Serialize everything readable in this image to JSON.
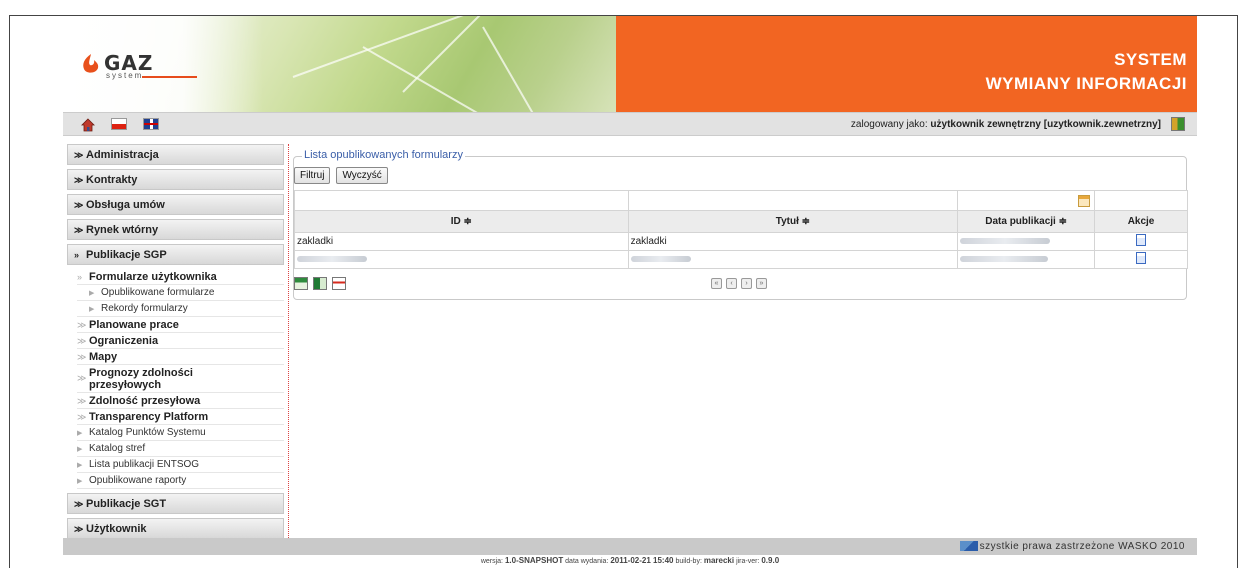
{
  "header": {
    "logo_word": "GAZ",
    "logo_sub": "system",
    "title_line1": "SYSTEM",
    "title_line2": "WYMIANY INFORMACJI",
    "colors": {
      "accent": "#f26522",
      "link": "#3a5ea8"
    }
  },
  "topbar": {
    "icons": [
      "home-icon",
      "polish-flag-icon",
      "english-flag-icon"
    ],
    "login_prefix": "zalogowany jako:",
    "login_user": "użytkownik zewnętrzny [uzytkownik.zewnetrzny]"
  },
  "sidebar": {
    "sections": {
      "administracja": "Administracja",
      "kontrakty": "Kontrakty",
      "obsluga_umow": "Obsługa umów",
      "rynek_wtorny": "Rynek wtórny",
      "publikacje_sgp": "Publikacje SGP",
      "publikacje_sgt": "Publikacje SGT",
      "uzytkownik": "Użytkownik"
    },
    "sgp_items": {
      "formularze": "Formularze użytkownika",
      "opublikowane_formularze": "Opublikowane formularze",
      "rekordy_formularzy": "Rekordy formularzy",
      "planowane_prace": "Planowane prace",
      "ograniczenia": "Ograniczenia",
      "mapy": "Mapy",
      "prognozy": "Prognozy zdolności przesyłowych",
      "zdolnosc": "Zdolność przesyłowa",
      "transparency": "Transparency Platform",
      "katalog_punktow": "Katalog Punktów Systemu",
      "katalog_stref": "Katalog stref",
      "lista_entsog": "Lista publikacji ENTSOG",
      "opublikowane_raporty": "Opublikowane raporty"
    }
  },
  "content": {
    "legend": "Lista opublikowanych formularzy",
    "filter_button": "Filtruj",
    "clear_button": "Wyczyść",
    "columns": {
      "id": "ID ≑",
      "title": "Tytuł ≑",
      "date": "Data publikacji ≑",
      "actions": "Akcje"
    },
    "rows": [
      {
        "id": "zakladki",
        "title": "zakladki"
      }
    ]
  },
  "footer": {
    "copyright": "szystkie prawa zastrzeżone WASKO 2010",
    "version_label": "wersja:",
    "version": "1.0-SNAPSHOT",
    "date_label": "data wydania:",
    "date": "2011-02-21 15:40",
    "build_label": "build-by:",
    "build": "marecki",
    "jira_label": "jira-ver:",
    "jira": "0.9.0"
  }
}
